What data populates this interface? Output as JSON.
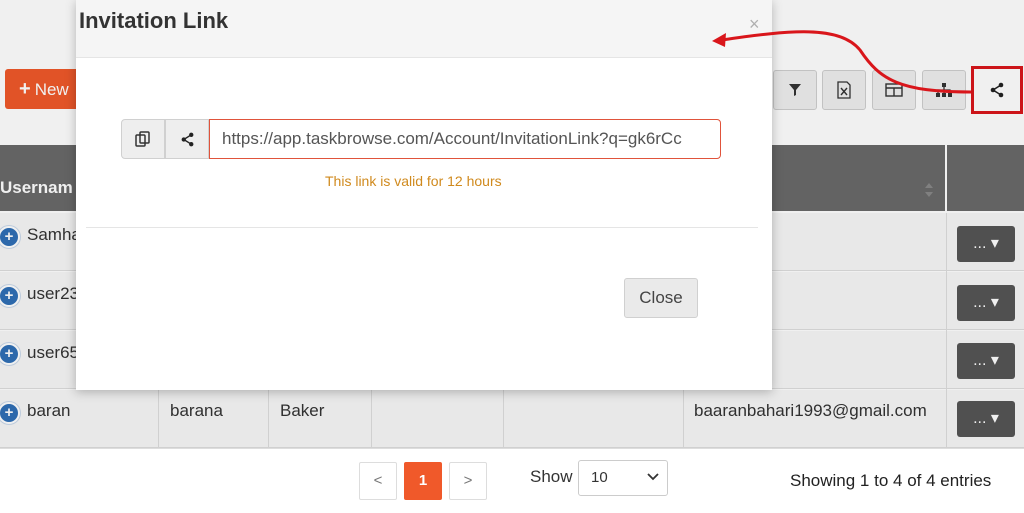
{
  "toolbar": {
    "new_label": "New",
    "icons": [
      "filter-icon",
      "excel-icon",
      "columns-icon",
      "hierarchy-icon",
      "share-icon"
    ]
  },
  "table": {
    "header_first": "Usernam",
    "rows": [
      {
        "username": "Samha",
        "first": "",
        "last": "",
        "email": ""
      },
      {
        "username": "user23",
        "first": "",
        "last": "",
        "email": ""
      },
      {
        "username": "user65",
        "first": "",
        "last": "",
        "email": ""
      },
      {
        "username": "baran",
        "first": "barana",
        "last": "Baker",
        "email": "baaranbahari1993@gmail.com"
      }
    ],
    "action_label": "..."
  },
  "pagination": {
    "prev": "<",
    "current": "1",
    "next": ">"
  },
  "show": {
    "label": "Show",
    "value": "10"
  },
  "info": "Showing 1 to 4 of 4 entries",
  "modal": {
    "title": "Invitation Link",
    "close_x": "×",
    "link_value": "https://app.taskbrowse.com/Account/InvitationLink?q=gk6rCc",
    "valid_text": "This link is valid for 12 hours",
    "close_label": "Close"
  },
  "colors": {
    "accent": "#f0592a",
    "highlight": "#d9161b",
    "warning_text": "#d08a1e"
  }
}
